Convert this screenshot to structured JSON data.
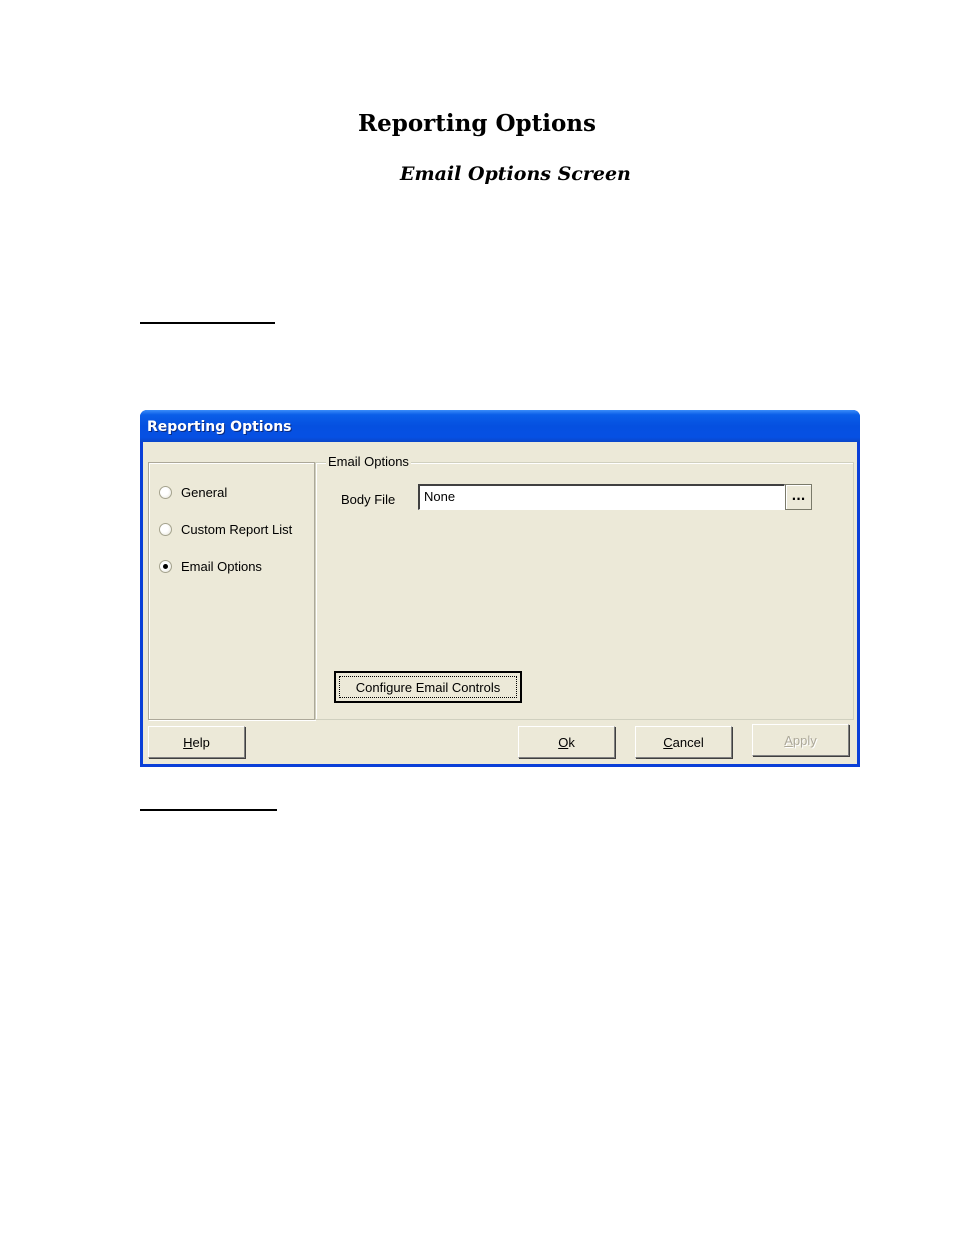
{
  "document": {
    "title": "Reporting Options",
    "subtitle": "Email Options Screen"
  },
  "dialog": {
    "title": "Reporting Options",
    "nav": {
      "options": [
        {
          "label": "General",
          "checked": false
        },
        {
          "label": "Custom Report List",
          "checked": false
        },
        {
          "label": "Email Options",
          "checked": true
        }
      ]
    },
    "group": {
      "legend": "Email Options",
      "body_file_label": "Body File",
      "body_file_value": "None",
      "browse_label": "...",
      "configure_label": "Configure Email Controls"
    },
    "buttons": {
      "help": {
        "first": "H",
        "rest": "elp"
      },
      "ok": {
        "first": "O",
        "rest": "k"
      },
      "cancel": {
        "first": "C",
        "rest": "ancel"
      },
      "apply": {
        "first": "A",
        "rest": "pply",
        "disabled": true
      }
    }
  }
}
